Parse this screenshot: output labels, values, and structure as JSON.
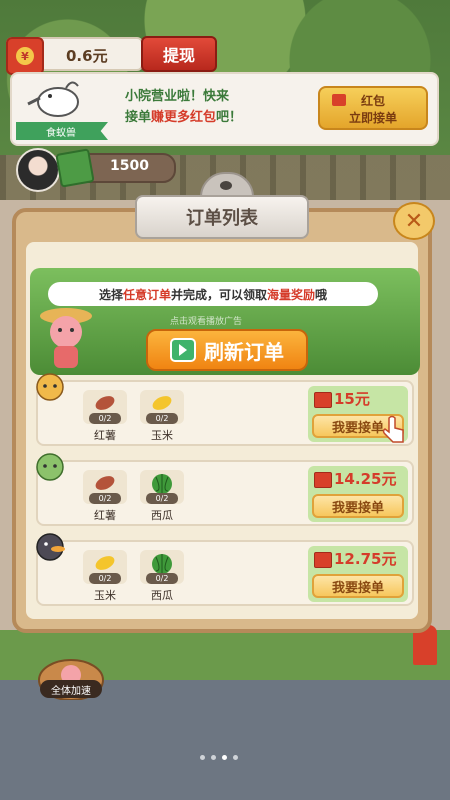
{
  "top": {
    "balance": "0.6元",
    "withdraw_label": "提现"
  },
  "banner": {
    "character_name": "食蚁兽",
    "line1": "小院营业啦！快来",
    "line2_a": "接单",
    "line2_b": "赚更多红包",
    "line2_c": "吧！",
    "button_line1": "红包",
    "button_line2": "立即接单"
  },
  "cash": {
    "value": "1500"
  },
  "modal": {
    "title": "订单列表",
    "close_label": "✕",
    "promo_a": "选择",
    "promo_b": "任意订单",
    "promo_c": "并完成，可以领取",
    "promo_d": "海量奖励",
    "promo_e": "哦",
    "ad_hint": "点击观看播放广告",
    "refresh_label": "刷新订单"
  },
  "orders": [
    {
      "items": [
        {
          "name": "红薯",
          "count": "0/2",
          "icon": "sweet-potato-icon"
        },
        {
          "name": "玉米",
          "count": "0/2",
          "icon": "corn-icon"
        }
      ],
      "reward": "15元",
      "button": "我要接单"
    },
    {
      "items": [
        {
          "name": "红薯",
          "count": "0/2",
          "icon": "sweet-potato-icon"
        },
        {
          "name": "西瓜",
          "count": "0/2",
          "icon": "watermelon-icon"
        }
      ],
      "reward": "14.25元",
      "button": "我要接单"
    },
    {
      "items": [
        {
          "name": "玉米",
          "count": "0/2",
          "icon": "corn-icon"
        },
        {
          "name": "西瓜",
          "count": "0/2",
          "icon": "watermelon-icon"
        }
      ],
      "reward": "12.75元",
      "button": "我要接单"
    }
  ],
  "bottom": {
    "speedup_label": "全体加速"
  },
  "colors": {
    "accent_red": "#d53c2a",
    "button_orange": "#f08412",
    "panel": "#f4ecd8"
  }
}
